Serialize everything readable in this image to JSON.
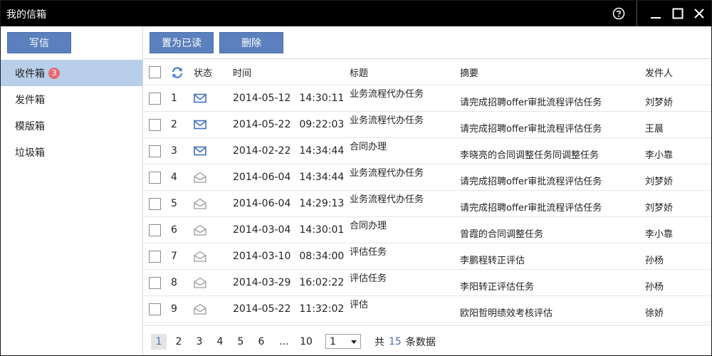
{
  "window": {
    "title": "我的信箱"
  },
  "sidebar": {
    "compose_label": "写信",
    "items": [
      {
        "label": "收件箱",
        "badge": "3",
        "active": true
      },
      {
        "label": "发件箱"
      },
      {
        "label": "模版箱"
      },
      {
        "label": "垃圾箱"
      }
    ]
  },
  "toolbar": {
    "mark_read_label": "置为已读",
    "delete_label": "删除"
  },
  "table": {
    "headers": {
      "status": "状态",
      "time": "时间",
      "title": "标题",
      "summary": "摘要",
      "sender": "发件人"
    },
    "rows": [
      {
        "num": "1",
        "status": "unread",
        "date": "2014-05-12",
        "clock": "14:30:11",
        "title": "业务流程代办任务",
        "summary": "请完成招聘offer审批流程评估任务",
        "sender": "刘梦娇"
      },
      {
        "num": "2",
        "status": "unread",
        "date": "2014-05-22",
        "clock": "09:22:03",
        "title": "业务流程代办任务",
        "summary": "请完成招聘offer审批流程评估任务",
        "sender": "王晨"
      },
      {
        "num": "3",
        "status": "unread",
        "date": "2014-02-22",
        "clock": "14:34:44",
        "title": "合同办理",
        "summary": "李晓亮的合同调整任务同调整任务",
        "sender": "李小靠"
      },
      {
        "num": "4",
        "status": "read",
        "date": "2014-06-04",
        "clock": "14:34:44",
        "title": "业务流程代办任务",
        "summary": "请完成招聘offer审批流程评估任务",
        "sender": "刘梦娇"
      },
      {
        "num": "5",
        "status": "read",
        "date": "2014-06-04",
        "clock": "14:29:13",
        "title": "业务流程代办任务",
        "summary": "请完成招聘offer审批流程评估任务",
        "sender": "刘梦娇"
      },
      {
        "num": "6",
        "status": "read",
        "date": "2014-03-04",
        "clock": "14:30:01",
        "title": "合同办理",
        "summary": "曾霞的合同调整任务",
        "sender": "李小靠"
      },
      {
        "num": "7",
        "status": "read",
        "date": "2014-03-10",
        "clock": "08:34:00",
        "title": "评估任务",
        "summary": "李鹏程转正评估",
        "sender": "孙杨"
      },
      {
        "num": "8",
        "status": "read",
        "date": "2014-03-29",
        "clock": "16:02:22",
        "title": "评估任务",
        "summary": "李阳转正评估任务",
        "sender": "孙杨"
      },
      {
        "num": "9",
        "status": "read",
        "date": "2014-05-22",
        "clock": "11:32:02",
        "title": "评估",
        "summary": "欧阳哲明绩效考核评估",
        "sender": "徐娇"
      }
    ]
  },
  "pager": {
    "pages": [
      "1",
      "2",
      "3",
      "4",
      "5",
      "6",
      "...",
      "10"
    ],
    "current": "1",
    "select_value": "1",
    "total_prefix": "共",
    "total_count": "15",
    "total_suffix": "条数据"
  },
  "colors": {
    "titlebar": "#000000",
    "primary_button": "#5b80bd",
    "active_nav": "#b9cfe9",
    "badge": "#e76a73",
    "unread_icon": "#3f6fc0",
    "read_icon": "#9a9a9a",
    "link_blue": "#4b6fb0"
  }
}
